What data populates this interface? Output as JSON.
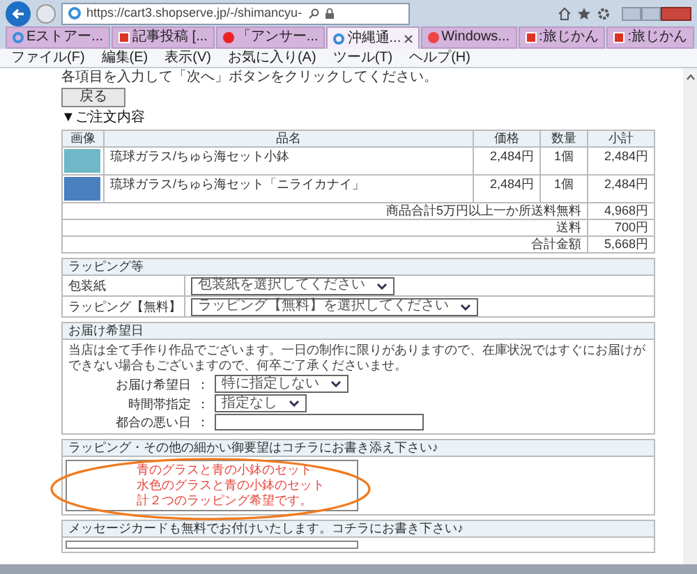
{
  "browser": {
    "address": "https://cart3.shopserve.jp/-/shimancyu-",
    "tabs": [
      {
        "title": "Eストアー...",
        "selected": false
      },
      {
        "title": "記事投稿 [...",
        "selected": false
      },
      {
        "title": "「アンサー...",
        "selected": false
      },
      {
        "title": "沖縄通...",
        "selected": true
      },
      {
        "title": "Windows...",
        "selected": false
      },
      {
        "title": ":旅じかん",
        "selected": false
      },
      {
        "title": ":旅じかん",
        "selected": false
      }
    ],
    "menu": [
      "ファイル(F)",
      "編集(E)",
      "表示(V)",
      "お気に入り(A)",
      "ツール(T)",
      "ヘルプ(H)"
    ]
  },
  "page": {
    "instruction": "各項目を入力して「次へ」ボタンをクリックしてください。",
    "back_button": "戻る",
    "order_heading": "▼ご注文内容",
    "order": {
      "columns": [
        "画像",
        "品名",
        "価格",
        "数量",
        "小計"
      ],
      "rows": [
        {
          "name": "琉球ガラス/ちゅら海セット小鉢",
          "price": "2,484円",
          "quantity": "1個",
          "subtotal": "2,484円"
        },
        {
          "name": "琉球ガラス/ちゅら海セット「ニライカナイ」",
          "price": "2,484円",
          "quantity": "1個",
          "subtotal": "2,484円"
        }
      ],
      "summary": [
        {
          "label": "商品合計5万円以上一か所送料無料",
          "value": "4,968円"
        },
        {
          "label": "送料",
          "value": "700円"
        },
        {
          "label": "合計金額",
          "value": "5,668円"
        }
      ]
    },
    "wrapping": {
      "title": "ラッピング等",
      "fields": [
        {
          "label": "包装紙",
          "value": "包装紙を選択してください"
        },
        {
          "label": "ラッピング【無料】",
          "value": "ラッピング【無料】を選択してください"
        }
      ]
    },
    "delivery": {
      "title": "お届け希望日",
      "notice": "当店は全て手作り作品でございます。一日の制作に限りがありますので、在庫状況ではすぐにお届けができない場合もございますので、何卒ご了承くださいませ。",
      "fields": [
        {
          "label": "お届け希望日",
          "separator": "：",
          "kind": "select",
          "value": "特に指定しない"
        },
        {
          "label": "時間帯指定",
          "separator": "：",
          "kind": "select",
          "value": "指定なし"
        },
        {
          "label": "都合の悪い日",
          "separator": "：",
          "kind": "text"
        }
      ]
    },
    "request": {
      "title": "ラッピング・その他の細かい御要望はコチラにお書き添え下さい♪",
      "lines": [
        "青のグラスと青の小鉢のセット",
        "水色のグラスと青の小鉢のセット",
        "計２つのラッピング希望です。"
      ],
      "highlighted": true
    },
    "message": {
      "title": "メッセージカードも無料でお付けいたします。コチラにお書き下さい♪"
    }
  }
}
